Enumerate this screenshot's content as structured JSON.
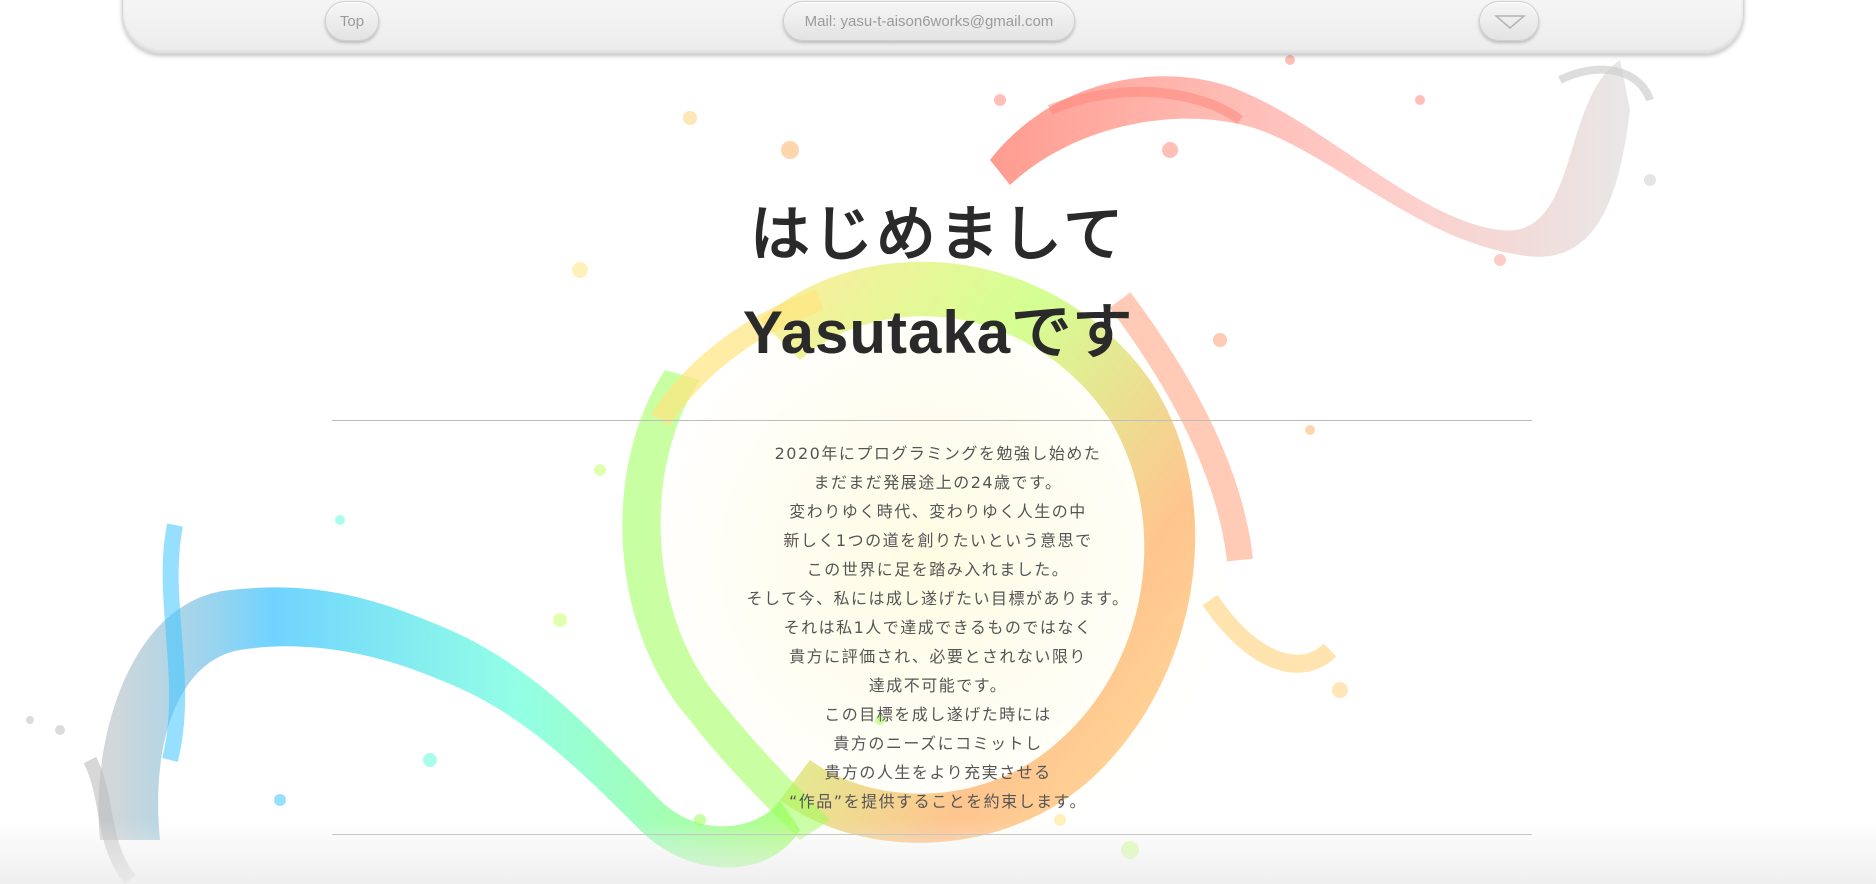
{
  "nav": {
    "top_label": "Top",
    "mail_label": "Mail: yasu-t-aison6works@gmail.com",
    "menu_icon": "triangle-down-icon"
  },
  "hero": {
    "line1": "はじめまして",
    "line2": "Yasutakaです"
  },
  "intro": {
    "lines": [
      "2020年にプログラミングを勉強し始めた",
      "まだまだ発展途上の24歳です。",
      "変わりゆく時代、変わりゆく人生の中",
      "新しく1つの道を創りたいという意思で",
      "この世界に足を踏み入れました。",
      "そして今、私には成し遂げたい目標があります。",
      "それは私1人で達成できるものではなく",
      "貴方に評価され、必要とされない限り",
      "達成不可能です。",
      "この目標を成し遂げた時には",
      "貴方のニーズにコミットし",
      "貴方の人生をより充実させる",
      "“作品”を提供することを約束します。"
    ]
  },
  "colors": {
    "heading": "#2a2a2a",
    "body_text": "#555555",
    "nav_text": "#9b9b9b",
    "splash": [
      "#ff8a80",
      "#ffb74d",
      "#fff176",
      "#b2ff59",
      "#69f0ae",
      "#4dd0e1",
      "#40c4ff",
      "#bdbdbd"
    ]
  }
}
